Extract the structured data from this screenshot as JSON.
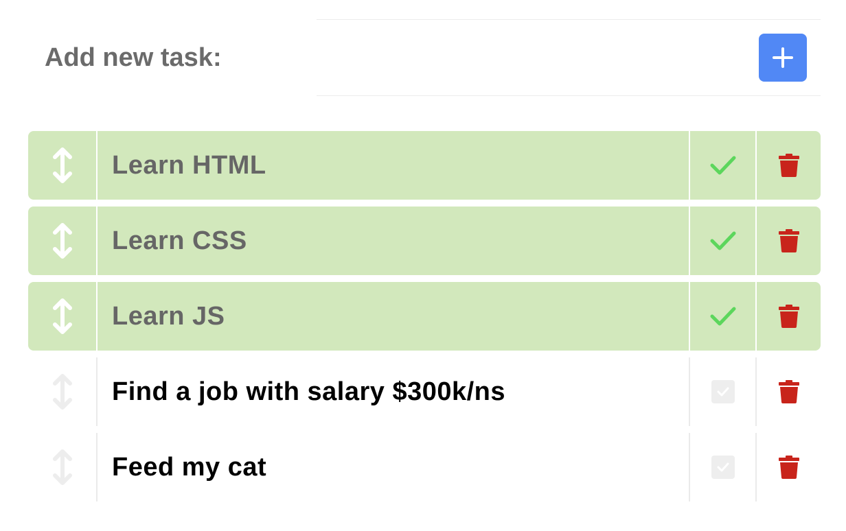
{
  "add_task": {
    "placeholder": "Add new task:",
    "add_button_icon": "plus-icon"
  },
  "colors": {
    "accent": "#5188f5",
    "done_row": "#d2e8bc",
    "check_green": "#5cd65c",
    "delete_red": "#c8241b",
    "muted_handle": "#ededed"
  },
  "tasks": [
    {
      "title": "Learn HTML",
      "done": true
    },
    {
      "title": "Learn CSS",
      "done": true
    },
    {
      "title": "Learn JS",
      "done": true
    },
    {
      "title": "Find a job with salary $300k/ns",
      "done": false
    },
    {
      "title": "Feed my cat",
      "done": false
    }
  ]
}
